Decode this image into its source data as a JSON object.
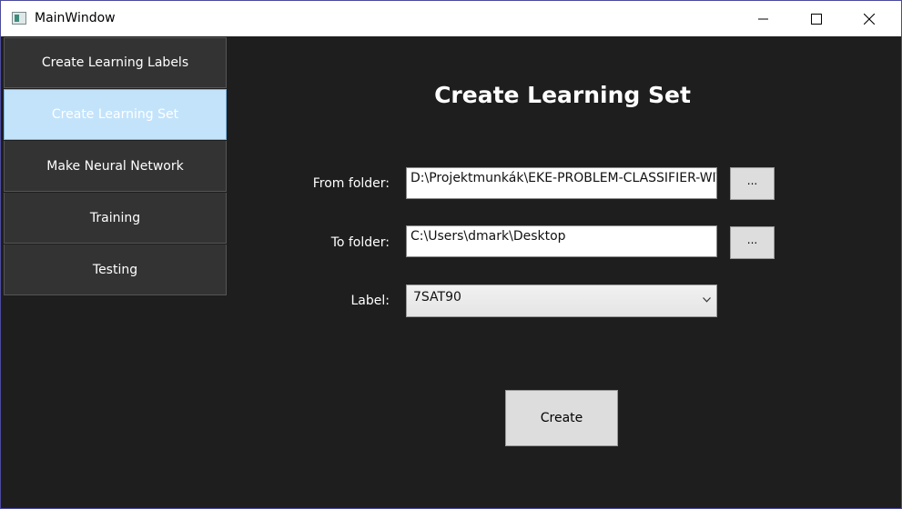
{
  "window": {
    "title": "MainWindow",
    "controls": {
      "minimize": "minimize-icon",
      "maximize": "maximize-icon",
      "close": "close-icon"
    }
  },
  "nav": {
    "items": [
      {
        "label": "Create Learning Labels",
        "active": false
      },
      {
        "label": "Create Learning Set",
        "active": true
      },
      {
        "label": "Make Neural Network",
        "active": false
      },
      {
        "label": "Training",
        "active": false
      },
      {
        "label": "Testing",
        "active": false
      }
    ]
  },
  "main": {
    "title": "Create Learning Set",
    "from_folder": {
      "label": "From folder:",
      "value": "D:\\Projektmunkák\\EKE-PROBLEM-CLASSIFIER-WITH",
      "browse_label": "..."
    },
    "to_folder": {
      "label": "To folder:",
      "value": "C:\\Users\\dmark\\Desktop",
      "browse_label": "..."
    },
    "label_field": {
      "label": "Label:",
      "selected": "7SAT90"
    },
    "create_label": "Create"
  },
  "colors": {
    "background": "#1e1e1e",
    "nav_item": "#333333",
    "nav_active": "#c3e3fb",
    "button": "#dddddd",
    "window_border": "#4a4a9c"
  }
}
